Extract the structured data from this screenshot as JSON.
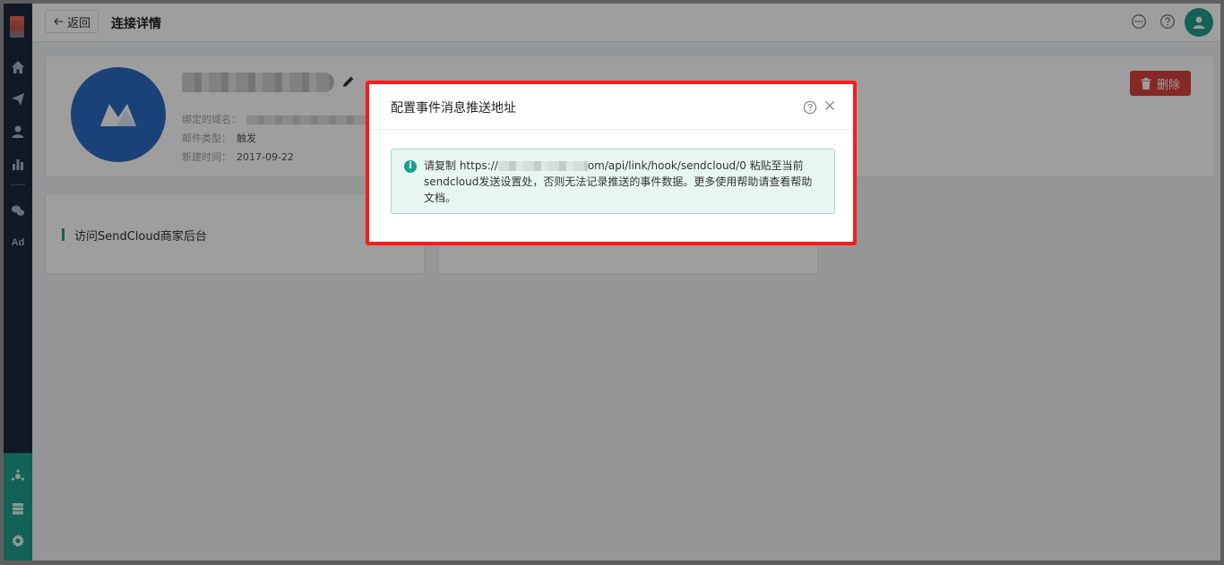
{
  "header": {
    "back_label": "返回",
    "page_title": "连接详情"
  },
  "detail": {
    "domain_label": "绑定的域名：",
    "mail_type_label": "邮件类型：",
    "mail_type_value": "触发",
    "created_label": "新建时间：",
    "created_value": "2017-09-22",
    "delete_label": "删除"
  },
  "visit": {
    "label": "访问SendCloud商家后台"
  },
  "sidebar": {
    "ad_label": "Ad"
  },
  "modal": {
    "title": "配置事件消息推送地址",
    "alert_prefix": "请复制 https://",
    "alert_suffix": "om/api/link/hook/sendcloud/0 粘贴至当前sendcloud发送设置处，否则无法记录推送的事件数据。更多使用帮助请查看帮助文档。"
  },
  "colors": {
    "sidebar": "#1c2b3a",
    "accent": "#1e9e8a",
    "danger": "#d9413b",
    "highlight": "#ff1a1a",
    "store_logo": "#2c6bc2"
  }
}
